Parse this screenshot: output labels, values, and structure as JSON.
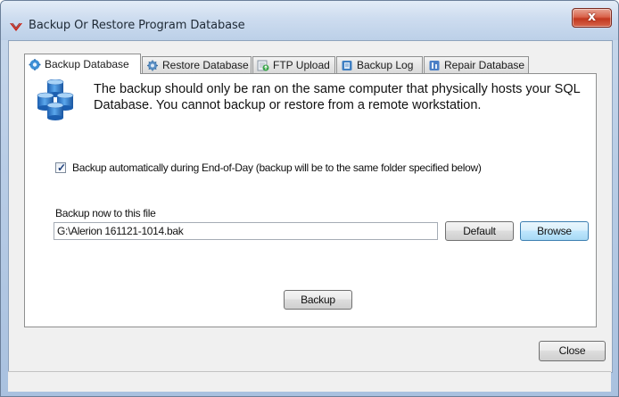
{
  "window": {
    "title": "Backup Or Restore Program Database",
    "close_glyph": "x",
    "app_icon": "red-chevron-logo-icon"
  },
  "tabs": [
    {
      "label": "Backup Database",
      "icon": "database-gear-icon",
      "active": true
    },
    {
      "label": "Restore Database",
      "icon": "restore-gear-icon",
      "active": false
    },
    {
      "label": "FTP Upload",
      "icon": "ftp-upload-icon",
      "active": false
    },
    {
      "label": "Backup Log",
      "icon": "backup-log-icon",
      "active": false
    },
    {
      "label": "Repair Database",
      "icon": "repair-database-icon",
      "active": false
    }
  ],
  "backup_tab": {
    "info_line1": "The backup should only be ran on the same computer that physically hosts your SQL",
    "info_line2": "Database.  You cannot backup or restore from a remote workstation.",
    "auto_backup_checked": true,
    "auto_backup_label": "Backup automatically during End-of-Day (backup will be to the same folder specified below)",
    "path_label": "Backup now to this file",
    "path_value": "G:\\Alerion 161121-1014.bak",
    "default_button": "Default",
    "browse_button": "Browse",
    "backup_button": "Backup"
  },
  "footer": {
    "close_button": "Close"
  },
  "colors": {
    "title_bar": "#cddcef",
    "close_button": "#c2381f",
    "client_background": "#f0f0f0",
    "tab_page": "#ffffff",
    "focus_button": "#bee6fd"
  }
}
